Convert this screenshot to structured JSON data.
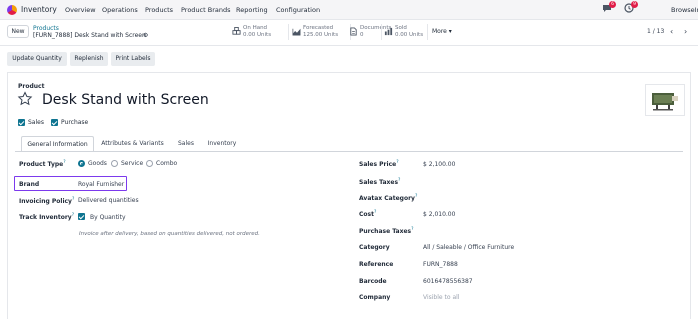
{
  "navbar": {
    "app_name": "Inventory",
    "menu": [
      "Overview",
      "Operations",
      "Products",
      "Product Brands",
      "Reporting",
      "Configuration"
    ],
    "chat_badge": "6",
    "activity_badge": "9",
    "company": "BrowseInfo"
  },
  "control_panel": {
    "new_label": "New",
    "breadcrumb_parent": "Products",
    "breadcrumb_current": "[FURN_7888] Desk Stand with Screen",
    "stats": [
      {
        "label": "On Hand",
        "value": "0.00 Units"
      },
      {
        "label": "Forecasted",
        "value": "125.00 Units"
      },
      {
        "label": "Documents",
        "value": "0"
      },
      {
        "label": "Sold",
        "value": "0.00 Units"
      }
    ],
    "more_label": "More",
    "pager": "1 / 13"
  },
  "actions": [
    "Update Quantity",
    "Replenish",
    "Print Labels"
  ],
  "product": {
    "label": "Product",
    "name": "Desk Stand with Screen",
    "sales_label": "Sales",
    "purchase_label": "Purchase"
  },
  "tabs": [
    "General Information",
    "Attributes & Variants",
    "Sales",
    "Inventory"
  ],
  "left_fields": {
    "product_type_label": "Product Type",
    "product_type_options": [
      "Goods",
      "Service",
      "Combo"
    ],
    "brand_label": "Brand",
    "brand_value": "Royal Furnisher",
    "invoicing_policy_label": "Invoicing Policy",
    "invoicing_policy_value": "Delivered quantities",
    "track_inventory_label": "Track Inventory",
    "track_inventory_value": "By Quantity",
    "hint": "Invoice after delivery, based on quantities delivered, not ordered."
  },
  "right_fields": {
    "sales_price_label": "Sales Price",
    "sales_price_value": "$ 2,100.00",
    "sales_taxes_label": "Sales Taxes",
    "avatax_label": "Avatax Category",
    "cost_label": "Cost",
    "cost_value": "$ 2,010.00",
    "purchase_taxes_label": "Purchase Taxes",
    "category_label": "Category",
    "category_value": "All / Saleable / Office Furniture",
    "reference_label": "Reference",
    "reference_value": "FURN_7888",
    "barcode_label": "Barcode",
    "barcode_value": "6016478556387",
    "company_label": "Company",
    "company_value": "Visible to all"
  },
  "colors": {
    "accent": "#0e7490",
    "highlight": "#7c3aed",
    "brand": "#714b67"
  }
}
